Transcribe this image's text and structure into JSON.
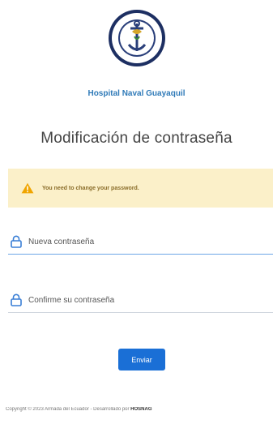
{
  "brand": {
    "logo_icon": "naval-emblem-seal",
    "logo_text": "ARMADA DEL ECUADOR · HOSPITAL GENERAL NAVAL",
    "name": "Hospital Naval Guayaquil"
  },
  "page": {
    "title": "Modificación de contraseña"
  },
  "alert": {
    "icon": "warning-icon",
    "text": "You need to change your password."
  },
  "form": {
    "password_placeholder": "Nueva contraseña",
    "confirm_placeholder": "Confirme su contraseña",
    "submit_label": "Enviar"
  },
  "footer": {
    "text": "Copyright © 2023 Armada del Ecuador - Desarrollado por ",
    "brand": "HOSNAG"
  },
  "colors": {
    "accent": "#1a6fd6",
    "alert_bg": "#fbf0c9",
    "org_name": "#2f7ab8"
  }
}
